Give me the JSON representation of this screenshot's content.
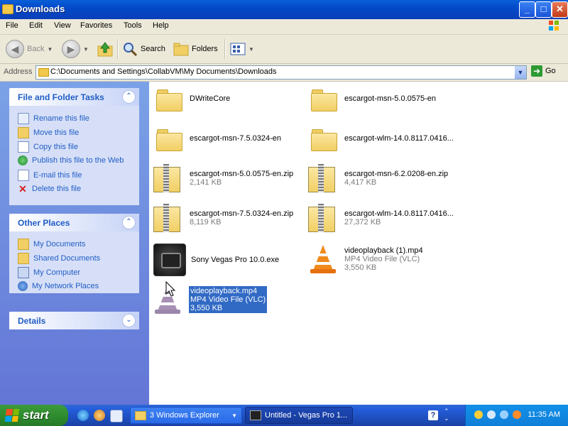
{
  "window": {
    "title": "Downloads"
  },
  "menu": [
    "File",
    "Edit",
    "View",
    "Favorites",
    "Tools",
    "Help"
  ],
  "toolbar": {
    "back": "Back",
    "search": "Search",
    "folders": "Folders"
  },
  "address": {
    "label": "Address",
    "path": "C:\\Documents and Settings\\CollabVM\\My Documents\\Downloads",
    "go": "Go"
  },
  "tasks": {
    "title": "File and Folder Tasks",
    "items": [
      "Rename this file",
      "Move this file",
      "Copy this file",
      "Publish this file to the Web",
      "E-mail this file",
      "Delete this file"
    ]
  },
  "places": {
    "title": "Other Places",
    "items": [
      "My Documents",
      "Shared Documents",
      "My Computer",
      "My Network Places"
    ]
  },
  "details": {
    "title": "Details"
  },
  "files": [
    {
      "name": "DWriteCore"
    },
    {
      "name": "escargot-msn-5.0.0575-en"
    },
    {
      "name": "escargot-msn-7.5.0324-en"
    },
    {
      "name": "escargot-wlm-14.0.8117.0416..."
    },
    {
      "name": "escargot-msn-5.0.0575-en.zip",
      "sub1": "2,141 KB"
    },
    {
      "name": "escargot-msn-6.2.0208-en.zip",
      "sub1": "4,417 KB"
    },
    {
      "name": "escargot-msn-7.5.0324-en.zip",
      "sub1": "8,119 KB"
    },
    {
      "name": "escargot-wlm-14.0.8117.0416...",
      "sub1": "27,372 KB"
    },
    {
      "name": "Sony Vegas Pro 10.0.exe"
    },
    {
      "name": "videoplayback (1).mp4",
      "sub1": "MP4 Video File (VLC)",
      "sub2": "3,550 KB"
    },
    {
      "name": "videoplayback.mp4",
      "sub1": "MP4 Video File (VLC)",
      "sub2": "3,550 KB"
    }
  ],
  "taskbar": {
    "start": "start",
    "buttons": [
      "3 Windows Explorer",
      "Untitled - Vegas Pro 1..."
    ],
    "clock": "11:35 AM"
  },
  "colors": {
    "title_bar": "#0a5fd8",
    "selection": "#316ac5",
    "task_link": "#215dc6",
    "taskbar": "#245edb",
    "start": "#2f8d2f"
  }
}
